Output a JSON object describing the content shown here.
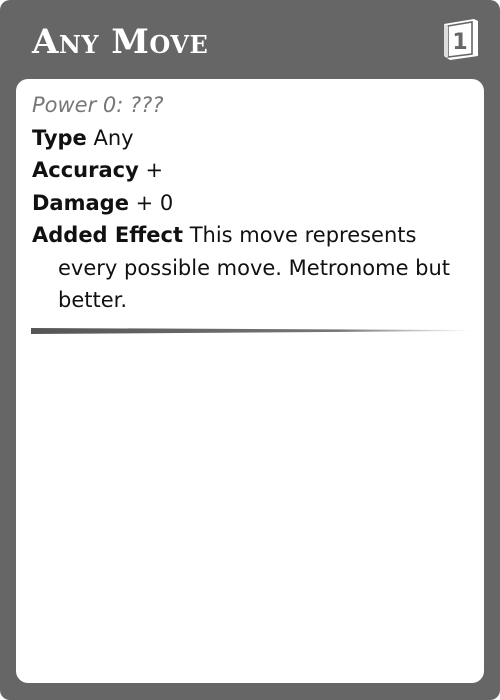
{
  "card": {
    "title": "Any Move",
    "level": "1",
    "colors": {
      "frame": "#666666",
      "body": "#ffffff",
      "power_text": "#777777"
    },
    "power": "Power 0: ???",
    "type": {
      "label": "Type",
      "value": "Any"
    },
    "accuracy": {
      "label": "Accuracy",
      "value": "+"
    },
    "damage": {
      "label": "Damage",
      "value": "+ 0"
    },
    "added_effect": {
      "label": "Added Effect",
      "value": "This move represents every possible move. Metronome but better."
    }
  }
}
